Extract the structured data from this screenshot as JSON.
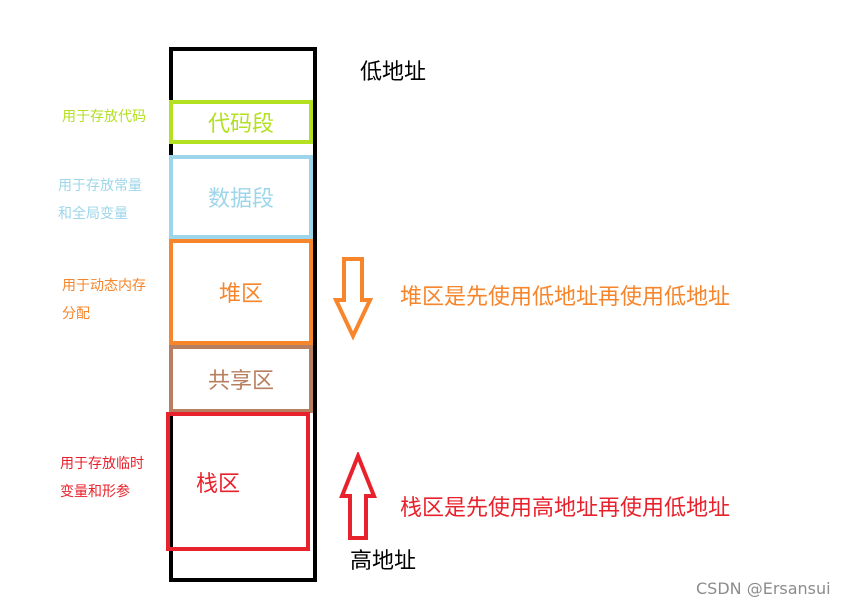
{
  "colors": {
    "outline": "#000000",
    "code": "#b3e020",
    "data": "#9dd6ea",
    "heap": "#f7852b",
    "shared": "#b77f5f",
    "stack": "#e8222c"
  },
  "labels": {
    "low_address": "低地址",
    "high_address": "高地址"
  },
  "segments": {
    "code": {
      "label": "代码段",
      "note_lines": [
        "用于存放代码"
      ]
    },
    "data": {
      "label": "数据段",
      "note_lines": [
        "用于存放常量",
        "和全局变量"
      ]
    },
    "heap": {
      "label": "堆区",
      "note_lines": [
        "用于动态内存",
        "分配"
      ],
      "arrow_text": "堆区是先使用低地址再使用低地址",
      "arrow_icon": "down-arrow-icon"
    },
    "shared": {
      "label": "共享区"
    },
    "stack": {
      "label": "栈区",
      "note_lines": [
        "用于存放临时",
        "变量和形参"
      ],
      "arrow_text": "栈区是先使用高地址再使用低地址",
      "arrow_icon": "up-arrow-icon"
    }
  },
  "watermark": "CSDN @Ersansui"
}
